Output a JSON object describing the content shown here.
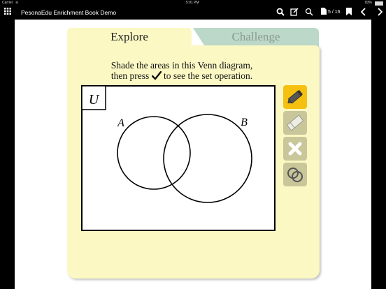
{
  "status_bar": {
    "carrier": "Carrier",
    "wifi_icon": "wifi-icon",
    "time": "5:01 PM",
    "battery": "83%"
  },
  "nav_bar": {
    "title": "PesonaEdu Enrichment Book Demo",
    "page_indicator": "5 / 16",
    "icons": [
      "grid-icon",
      "zoom-in-icon",
      "edit-icon",
      "search-icon",
      "page-icon",
      "bookmark-icon",
      "chevron-left-icon",
      "chevron-right-icon"
    ]
  },
  "tabs": [
    {
      "label": "Explore",
      "active": true
    },
    {
      "label": "Challenge",
      "active": false
    }
  ],
  "instruction": {
    "line1": "Shade the areas in this Venn diagram,",
    "line2_before": "then press",
    "line2_after": "to see the set operation."
  },
  "venn": {
    "universe_label": "U",
    "set_a_label": "A",
    "set_b_label": "B"
  },
  "tools": [
    "pencil-icon",
    "eraser-icon",
    "clear-icon",
    "venn-icon"
  ],
  "colors": {
    "panel": "#fbf8c4",
    "active_tool": "#f5c010",
    "inactive_tool": "#c9c69a",
    "challenge_tab": "#bcd8c8"
  }
}
